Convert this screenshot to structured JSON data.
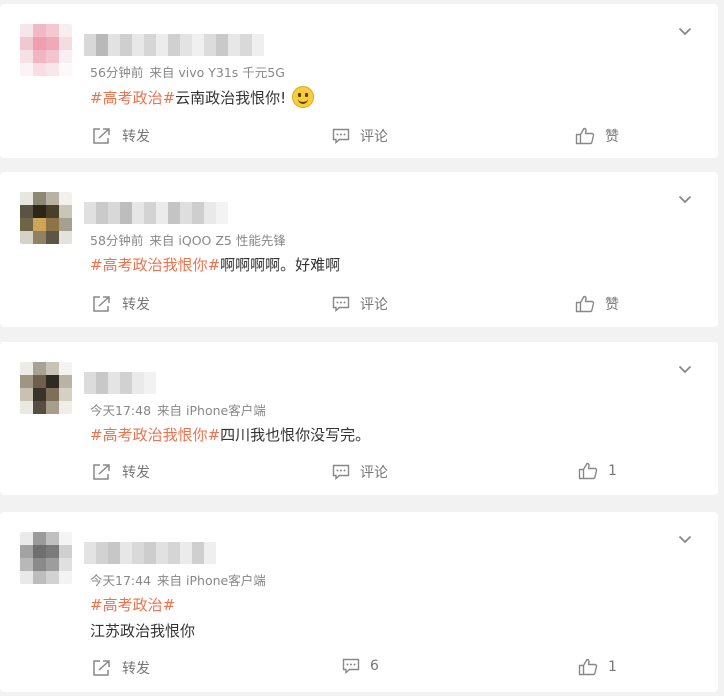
{
  "posts": [
    {
      "meta_time": "56分钟前",
      "meta_source": "来自 vivo Y31s 千元5G",
      "topic": "#高考政治#",
      "body": "云南政治我恨你!",
      "repost_label": "转发",
      "comment_label": "评论",
      "like_label": "赞",
      "emoji": "smile-emoji"
    },
    {
      "meta_time": "58分钟前",
      "meta_source": "来自 iQOO Z5 性能先锋",
      "topic": "#高考政治我恨你#",
      "body": "啊啊啊啊。好难啊",
      "repost_label": "转发",
      "comment_label": "评论",
      "like_label": "赞"
    },
    {
      "meta_time": "今天17:48",
      "meta_source": "来自 iPhone客户端",
      "topic": "#高考政治我恨你#",
      "body": "四川我也恨你没写完。",
      "repost_label": "转发",
      "comment_label": "评论",
      "like_label": "1"
    },
    {
      "meta_time": "今天17:44",
      "meta_source": "来自 iPhone客户端",
      "topic": "#高考政治#",
      "body": "江苏政治我恨你",
      "repost_label": "转发",
      "comment_label": "6",
      "like_label": "1"
    }
  ],
  "colors": {
    "topic": "#eb7350",
    "meta": "#888888",
    "text": "#333333",
    "background": "#f2f2f2"
  },
  "icons": [
    "chevron-down-icon",
    "repost-icon",
    "comment-icon",
    "like-icon"
  ]
}
